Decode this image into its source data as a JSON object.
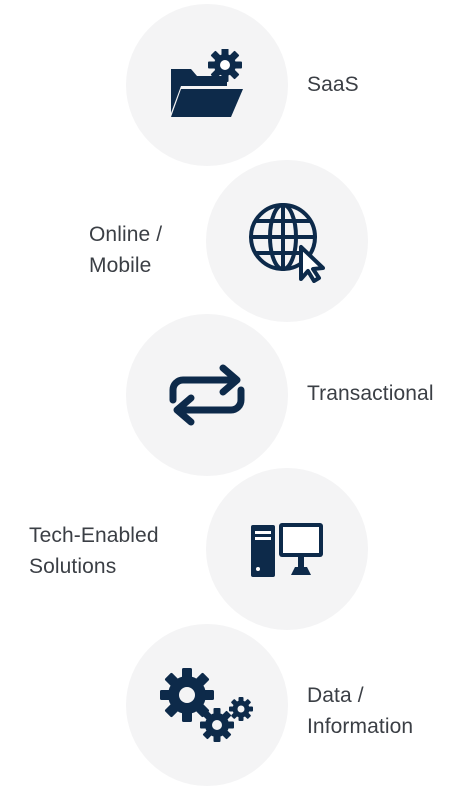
{
  "colors": {
    "icon": "#0d2a4a",
    "circle": "#f4f4f5",
    "text": "#3b3f45"
  },
  "items": [
    {
      "icon": "folder-gear-icon",
      "label_lines": [
        "SaaS"
      ]
    },
    {
      "icon": "globe-cursor-icon",
      "label_lines": [
        "Online /",
        "Mobile"
      ]
    },
    {
      "icon": "repeat-arrows-icon",
      "label_lines": [
        "Transactional"
      ]
    },
    {
      "icon": "desktop-computer-icon",
      "label_lines": [
        "Tech-Enabled",
        "Solutions"
      ]
    },
    {
      "icon": "gears-icon",
      "label_lines": [
        "Data /",
        "Information"
      ]
    }
  ]
}
